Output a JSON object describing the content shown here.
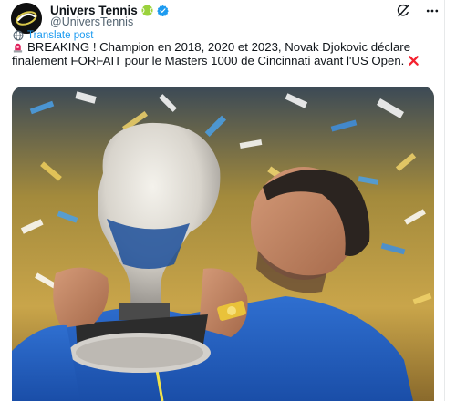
{
  "account": {
    "display_name": "Univers Tennis",
    "handle": "@UniversTennis",
    "avatar_icon": "univers-tennis-logo",
    "badge_icons": [
      "tennis-ball-icon",
      "verified-badge-icon"
    ]
  },
  "translate": {
    "label": "Translate post",
    "icon": "globe-icon"
  },
  "post": {
    "text_prefix_icon": "rotating-light-icon",
    "text": "BREAKING ! Champion en 2018, 2020 et 2023, Novak Djokovic déclare finalement FORFAIT pour le Masters 1000 de Cincinnati avant l'US Open.",
    "text_suffix_icon": "cross-mark-icon"
  },
  "top_actions": [
    "grok-icon",
    "more-icon"
  ],
  "colors": {
    "link": "#1d9bf0",
    "text": "#0f1419",
    "secondary": "#536471",
    "verified": "#1d9bf0",
    "cross": "#f4212e"
  }
}
